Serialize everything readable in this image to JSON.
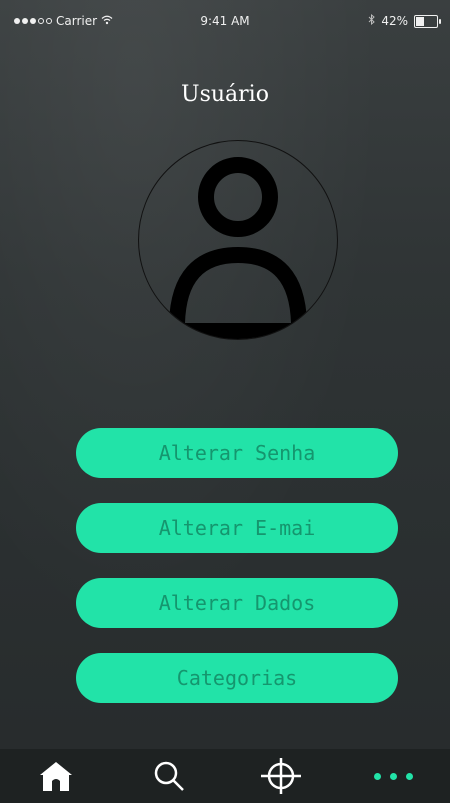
{
  "status_bar": {
    "carrier": "Carrier",
    "time": "9:41 AM",
    "battery_percent": "42%",
    "battery_level": 0.42
  },
  "header": {
    "title": "Usuário"
  },
  "avatar": {
    "icon": "user-avatar-icon"
  },
  "menu": {
    "items": [
      {
        "label": "Alterar Senha"
      },
      {
        "label": "Alterar E-mai"
      },
      {
        "label": "Alterar Dados"
      },
      {
        "label": "Categorias"
      }
    ]
  },
  "tab_bar": {
    "items": [
      {
        "icon": "home-icon"
      },
      {
        "icon": "search-icon"
      },
      {
        "icon": "crosshair-icon"
      },
      {
        "icon": "more-icon"
      }
    ]
  },
  "colors": {
    "accent": "#22e3a8",
    "button_text": "#15966e",
    "background": "#2b2f30",
    "tab_bar": "#1e2222"
  }
}
